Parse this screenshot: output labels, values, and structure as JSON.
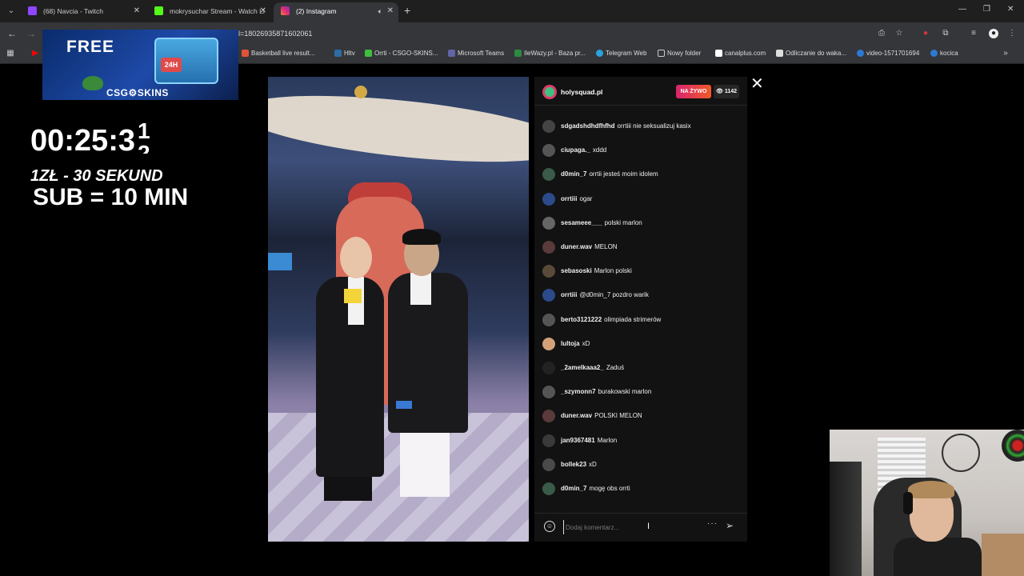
{
  "browser": {
    "tabs": [
      {
        "label": "(68) Navcia - Twitch",
        "active": false,
        "favicon_color": "#9146ff"
      },
      {
        "label": "mokrysuchar Stream - Watch Li",
        "active": false,
        "favicon_color": "#53fc18"
      },
      {
        "label": "(2) Instagram",
        "active": true,
        "favicon_color": "#e1306c"
      }
    ],
    "url": "l=18026935871602061",
    "bookmarks": [
      {
        "label": "Basketball live result...",
        "color": "#e0533a"
      },
      {
        "label": "Hltv",
        "color": "#2d6da3"
      },
      {
        "label": "Orrti - CSGO-SKINS...",
        "color": "#3fbf3f"
      },
      {
        "label": "Microsoft Teams",
        "color": "#6264a7"
      },
      {
        "label": "IleWazy.pl - Baza pr...",
        "color": "#2d8a3f"
      },
      {
        "label": "Telegram Web",
        "color": "#2aa3df"
      },
      {
        "label": "Nowy folder",
        "color": "#cccccc"
      },
      {
        "label": "canalplus.com",
        "color": "#ffffff"
      },
      {
        "label": "Odliczanie do waka...",
        "color": "#dddddd"
      },
      {
        "label": "video-1571701694",
        "color": "#2a7ad4"
      },
      {
        "label": "kocica",
        "color": "#2a7ad4"
      }
    ]
  },
  "overlay": {
    "ad_title": "FREE",
    "ad_badge": "24H",
    "ad_brand": "CSG⚙SKINS",
    "timer": "00:25:3",
    "timer_fraction_top": "1",
    "timer_fraction_bottom": "2",
    "rate": "1ZŁ - 30 SEKUND",
    "sub": "SUB = 10 MIN"
  },
  "live": {
    "host": "holysquad.pl",
    "live_badge": "NA ŻYWO",
    "viewers": "1142",
    "comments": [
      {
        "user": "sdgadshdhdfhfhd",
        "text": "orrtiii nie seksualizuj kasix",
        "avatar_color": "#444"
      },
      {
        "user": "ciupaga._",
        "text": "xddd",
        "avatar_color": "#555"
      },
      {
        "user": "d0min_7",
        "text": "orrtii jesteś moim idolem",
        "avatar_color": "#3b5a4a"
      },
      {
        "user": "orrtiii",
        "text": "ogar",
        "avatar_color": "#2c4a8a"
      },
      {
        "user": "sesameee___",
        "text": "polski marlon",
        "avatar_color": "#666"
      },
      {
        "user": "duner.wav",
        "text": "MELON",
        "avatar_color": "#5a3a3a"
      },
      {
        "user": "sebasoski",
        "text": "Marlon polski",
        "avatar_color": "#5a4a3a"
      },
      {
        "user": "orrtiii",
        "text": "@d0min_7 pozdro warik",
        "avatar_color": "#2c4a8a"
      },
      {
        "user": "berto3121222",
        "text": "olimpiada strimerów",
        "avatar_color": "#555"
      },
      {
        "user": "lultoja",
        "text": "xD",
        "avatar_color": "#d4a07a"
      },
      {
        "user": "_2amelkaaa2_",
        "text": "Zaduś",
        "avatar_color": "#222"
      },
      {
        "user": "_szymonn7",
        "text": "burakowski marlon",
        "avatar_color": "#555"
      },
      {
        "user": "duner.wav",
        "text": "POLSKI MELON",
        "avatar_color": "#5a3a3a"
      },
      {
        "user": "jan9367481",
        "text": "Marlon",
        "avatar_color": "#3a3a3a"
      },
      {
        "user": "bollek23",
        "text": "xD",
        "avatar_color": "#4a4a4a"
      },
      {
        "user": "d0min_7",
        "text": "mogę obs orrti",
        "avatar_color": "#3b5a4a"
      }
    ],
    "input_placeholder": "Dodaj komentarz..."
  }
}
